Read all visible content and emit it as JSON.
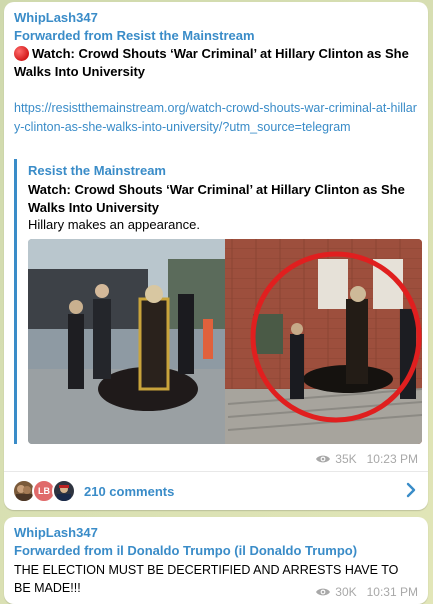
{
  "message1": {
    "sender": "WhipLash347",
    "forwarded": "Forwarded from Resist the Mainstream",
    "title": "Watch: Crowd Shouts ‘War Criminal’ at Hillary Clinton as She Walks Into University",
    "link": "https://resistthemainstream.org/watch-crowd-shouts-war-criminal-at-hillary-clinton-as-she-walks-into-university/?utm_source=telegram",
    "preview": {
      "site": "Resist the Mainstream",
      "title": "Watch: Crowd Shouts ‘War Criminal’ at Hillary Clinton as She Walks Into University",
      "description": "Hillary makes an appearance."
    },
    "views": "35K",
    "time": "10:23 PM",
    "comments": {
      "label": "210 comments",
      "avatar_initials": "LB"
    }
  },
  "message2": {
    "sender": "WhipLash347",
    "forwarded": "Forwarded from il Donaldo Trumpo (il Donaldo Trumpo)",
    "text": "THE ELECTION MUST BE DECERTIFIED AND ARRESTS HAVE TO BE MADE!!!",
    "views": "30K",
    "time": "10:31 PM"
  },
  "colors": {
    "accent": "#3a8cc8",
    "meta": "#a8a8a8",
    "background": "#d7dcb4"
  },
  "icons": [
    "red-circle-emoji-icon",
    "eye-icon",
    "chevron-right-icon"
  ]
}
